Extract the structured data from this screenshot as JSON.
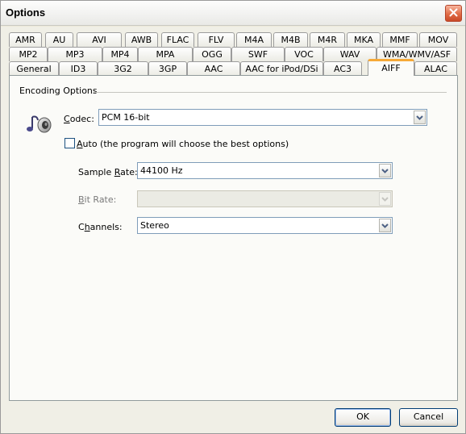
{
  "window": {
    "title": "Options"
  },
  "tabs": {
    "row1": [
      "AMR",
      "AU",
      "AVI",
      "AWB",
      "FLAC",
      "FLV",
      "M4A",
      "M4B",
      "M4R",
      "MKA",
      "MMF",
      "MOV"
    ],
    "row2": [
      "MP2",
      "MP3",
      "MP4",
      "MPA",
      "OGG",
      "SWF",
      "VOC",
      "WAV",
      "WMA/WMV/ASF"
    ],
    "row3": [
      "General",
      "ID3",
      "3G2",
      "3GP",
      "AAC",
      "AAC for iPod/DSi",
      "AC3",
      "AIFF",
      "ALAC"
    ],
    "active": "AIFF"
  },
  "encoding": {
    "group_label": "Encoding Options",
    "codec_label_u": "C",
    "codec_label_rest": "odec:",
    "codec_value": "PCM 16-bit",
    "auto_label_u": "A",
    "auto_label_rest": "uto (the program will choose the best options)",
    "auto_checked": false,
    "sample_rate_label_a": "Sample ",
    "sample_rate_label_u": "R",
    "sample_rate_label_b": "ate:",
    "sample_rate_value": "44100 Hz",
    "bit_rate_label_u": "B",
    "bit_rate_label_rest": "it Rate:",
    "bit_rate_value": "",
    "channels_label_a": "C",
    "channels_label_u": "h",
    "channels_label_b": "annels:",
    "channels_value": "Stereo"
  },
  "buttons": {
    "ok": "OK",
    "cancel": "Cancel"
  },
  "icons": {
    "close": "close-icon",
    "codec": "music-speaker-icon",
    "dropdown": "chevron-down-icon"
  }
}
